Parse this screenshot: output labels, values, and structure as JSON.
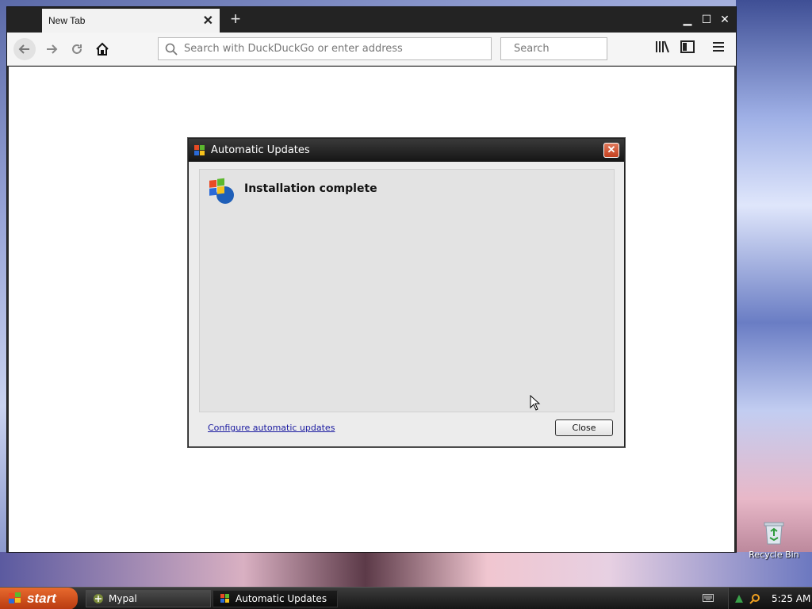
{
  "browser": {
    "tab": {
      "title": "New Tab"
    },
    "address": {
      "placeholder": "Search with DuckDuckGo or enter address"
    },
    "search": {
      "placeholder": "Search"
    }
  },
  "dialog": {
    "title": "Automatic Updates",
    "heading": "Installation complete",
    "link": "Configure automatic updates",
    "close_label": "Close"
  },
  "desktop": {
    "recycle_bin_label": "Recycle Bin"
  },
  "taskbar": {
    "start_label": "start",
    "items": [
      {
        "label": "Mypal"
      },
      {
        "label": "Automatic Updates"
      }
    ],
    "clock": "5:25 AM"
  },
  "colors": {
    "start_orange": "#d0521e",
    "link_blue": "#1a1aa0",
    "dialog_close_red": "#c4401f"
  }
}
